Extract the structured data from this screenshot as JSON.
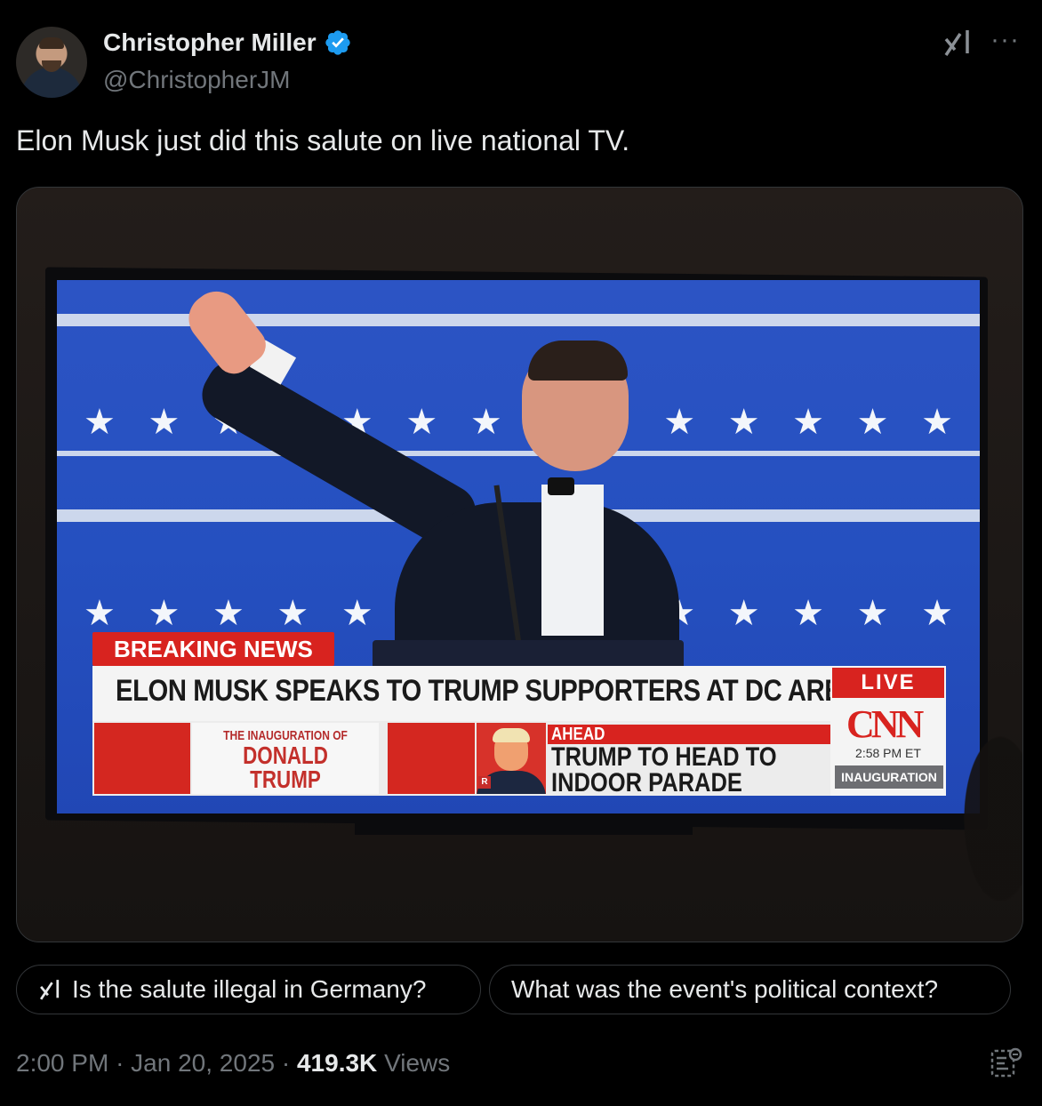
{
  "author": {
    "name": "Christopher Miller",
    "handle": "@ChristopherJM",
    "verified": true
  },
  "tweet": {
    "text": "Elon Musk just did this salute on live national TV."
  },
  "media": {
    "chyron": {
      "breaking": "BREAKING NEWS",
      "headline": "ELON MUSK SPEAKS TO TRUMP SUPPORTERS AT DC ARENA",
      "inauguration_small": "THE INAUGURATION OF",
      "inauguration_big_1": "DONALD",
      "inauguration_big_2": "TRUMP",
      "ahead_label": "AHEAD",
      "ahead_line_1": "TRUMP TO HEAD TO",
      "ahead_line_2": "INDOOR PARADE",
      "live": "LIVE",
      "network": "CNN",
      "time": "2:58 PM ET",
      "tag": "INAUGURATION",
      "party_tag": "R"
    }
  },
  "grok_prompts": [
    "Is the salute illegal in Germany?",
    "What was the event's political context?"
  ],
  "meta": {
    "time": "2:00 PM",
    "sep": "·",
    "date": "Jan 20, 2025",
    "views_count": "419.3K",
    "views_label": "Views"
  },
  "icons": {
    "verified": "verified-badge-icon",
    "grok": "grok-icon",
    "more": "more-icon",
    "analytics": "analytics-icon"
  },
  "colors": {
    "background": "#000000",
    "text": "#e7e9ea",
    "secondary": "#71767b",
    "verified": "#1d9bf0",
    "border": "#333639"
  }
}
